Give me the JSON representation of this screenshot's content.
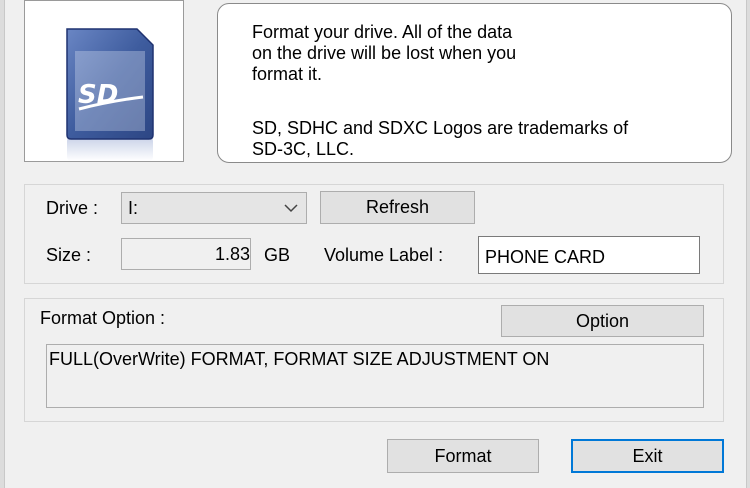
{
  "logo": {
    "card_text": "SD"
  },
  "info": {
    "paragraph1": "Format your drive. All of the data\non the drive will be lost when you\nformat it.",
    "paragraph2": "SD, SDHC and SDXC Logos are trademarks of\nSD-3C, LLC."
  },
  "drive": {
    "label": "Drive :",
    "selected": "I:",
    "refresh_label": "Refresh"
  },
  "size": {
    "label": "Size  :",
    "value": "1.83",
    "unit": "GB"
  },
  "volume": {
    "label": "Volume Label  :",
    "value": "PHONE CARD"
  },
  "format_option": {
    "label": "Format Option :",
    "option_button": "Option",
    "text": "FULL(OverWrite) FORMAT, FORMAT SIZE ADJUSTMENT ON"
  },
  "actions": {
    "format_label": "Format",
    "exit_label": "Exit"
  },
  "colors": {
    "card_body": "#3e5c9e",
    "default_button_border": "#0078d7"
  }
}
